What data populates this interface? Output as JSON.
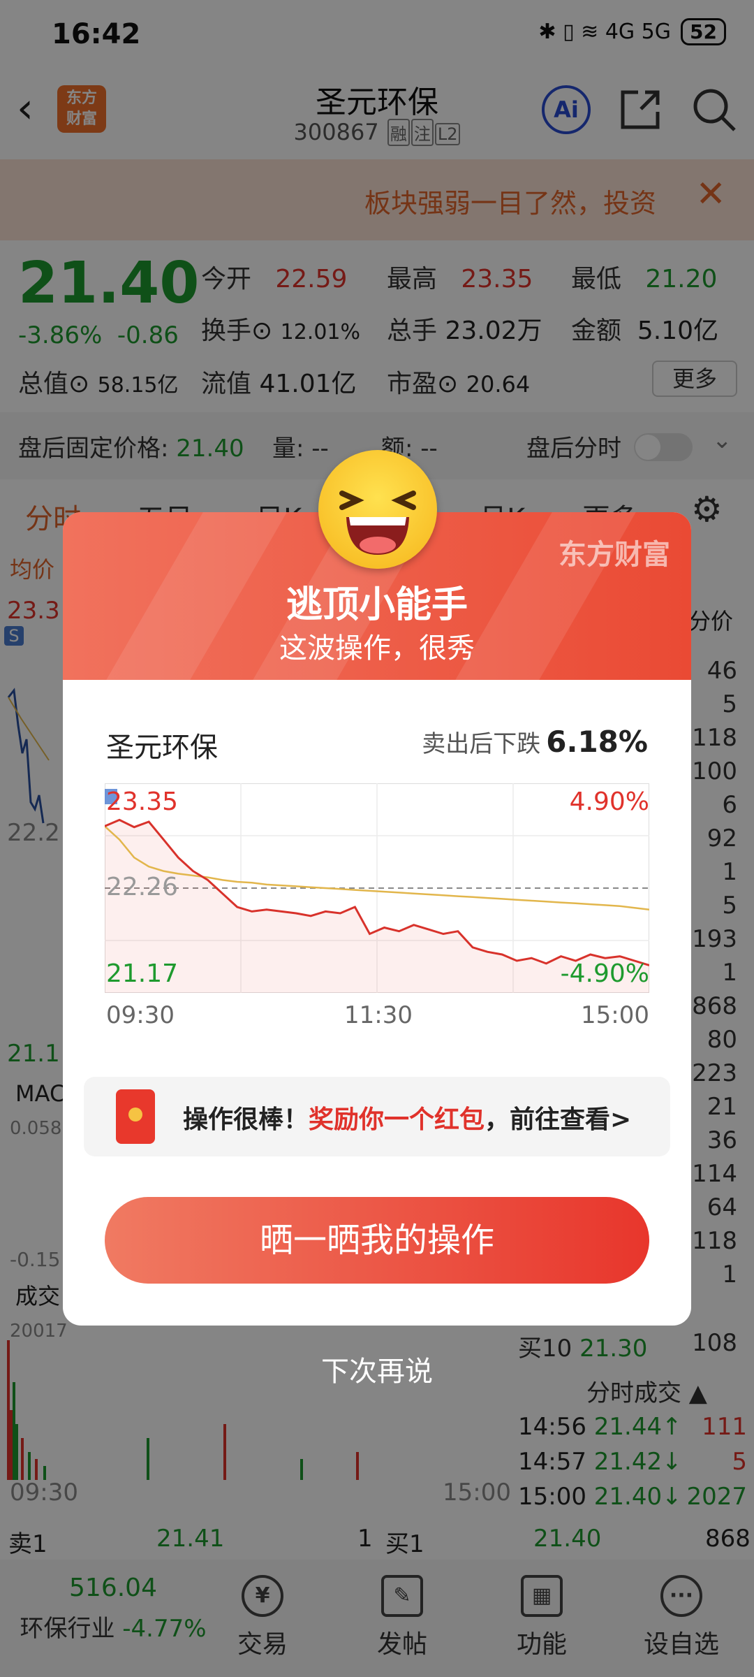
{
  "status_bar": {
    "time": "16:42",
    "signals": "✱ ▯ ≋ 4G 5G",
    "battery": "52"
  },
  "header": {
    "logo_text": "东方\n财富",
    "stock_name": "圣元环保",
    "stock_code": "300867",
    "tags": [
      "融",
      "注",
      "L2"
    ]
  },
  "banner": {
    "text": "板块强弱一目了然，投资",
    "close": "✕"
  },
  "quote": {
    "price": "21.40",
    "change_pct": "-3.86%",
    "change": "-0.86",
    "open_label": "今开",
    "open": "22.59",
    "high_label": "最高",
    "high": "23.35",
    "low_label": "最低",
    "low": "21.20",
    "turnover_label": "换手",
    "turnover": "12.01%",
    "volume_label": "总手",
    "volume": "23.02万",
    "amount_label": "金额",
    "amount": "5.10亿",
    "mcap_label": "总值",
    "mcap": "58.15亿",
    "float_label": "流值",
    "float": "41.01亿",
    "pe_label": "市盈",
    "pe": "20.64",
    "more": "更多"
  },
  "after_hours": {
    "label": "盘后固定价格:",
    "price": "21.40",
    "vol": "量: --",
    "amt": "额: --",
    "toggle_label": "盘后分时"
  },
  "tabs": [
    "分时",
    "五日",
    "日K",
    "周K",
    "月K",
    "更多"
  ],
  "side_labels": {
    "avg": "均价",
    "high": "23.3",
    "mid": "22.2",
    "low": "21.1",
    "macd": "MAC",
    "macd_val": "0.058",
    "macd_low": "-0.15",
    "vol_label": "成交",
    "vol_max": "20017",
    "t_start": "09:30",
    "t_end": "15:00",
    "depth_label": "分价"
  },
  "right_list": [
    "46",
    "5",
    "118",
    "100",
    "6",
    "92",
    "1",
    "5",
    "193",
    "1",
    "868",
    "80",
    "223",
    "21",
    "36",
    "114",
    "64",
    "118",
    "1"
  ],
  "bid10": {
    "label": "买10",
    "price": "21.30",
    "vol": "108"
  },
  "ticks_title": "分时成交",
  "ticks": [
    {
      "time": "14:56",
      "price": "21.44↑",
      "vol": "111"
    },
    {
      "time": "14:57",
      "price": "21.42↓",
      "vol": "5"
    },
    {
      "time": "15:00",
      "price": "21.40↓",
      "vol": "2027"
    }
  ],
  "bidbar": {
    "sell1": "卖1",
    "sell1_price": "21.41",
    "sell1_vol": "1",
    "buy1": "买1",
    "buy1_price": "21.40",
    "buy1_vol": "868"
  },
  "bottom_nav": {
    "sector_value": "516.04",
    "sector_name": "环保行业",
    "sector_chg": "-4.77%",
    "items": [
      "交易",
      "发帖",
      "功能",
      "设自选"
    ]
  },
  "modal": {
    "brand": "东方财富",
    "title": "逃顶小能手",
    "subtitle": "这波操作，很秀",
    "stock": "圣元环保",
    "drop_label": "卖出后下跌",
    "drop_value": "6.18%",
    "chart_high": "23.35",
    "chart_mid": "22.26",
    "chart_low": "21.17",
    "pct_high": "4.90%",
    "pct_low": "-4.90%",
    "x_start": "09:30",
    "x_mid": "11:30",
    "x_end": "15:00",
    "rp_a": "操作很棒！",
    "rp_b": "奖励你一个红包",
    "rp_c": "，前往查看>",
    "share_button": "晒一晒我的操作"
  },
  "later": "下次再说",
  "chart_data": {
    "type": "line",
    "series": [
      {
        "values": [
          22.95,
          23.02,
          22.94,
          23.0,
          22.8,
          22.6,
          22.45,
          22.35,
          22.2,
          22.05,
          22.0,
          22.02,
          22.0,
          21.98,
          21.95,
          22.0,
          21.98,
          22.05,
          21.75,
          21.82,
          21.78,
          21.85,
          21.8,
          21.75,
          21.78,
          21.6,
          21.55,
          21.52,
          21.45,
          21.48,
          21.42,
          21.5,
          21.45,
          21.52,
          21.48,
          21.5,
          21.45,
          21.4
        ]
      },
      {
        "values": [
          22.95,
          22.8,
          22.6,
          22.5,
          22.45,
          22.42,
          22.4,
          22.38,
          22.35,
          22.33,
          22.32,
          22.3,
          22.29,
          22.28,
          22.27,
          22.26,
          22.25,
          22.24,
          22.23,
          22.22,
          22.21,
          22.2,
          22.19,
          22.18,
          22.17,
          22.16,
          22.15,
          22.14,
          22.13,
          22.12,
          22.11,
          22.1,
          22.09,
          22.08,
          22.07,
          22.06,
          22.04,
          22.02
        ]
      }
    ],
    "ylim": [
      21.17,
      23.35
    ],
    "reference": 22.26,
    "x_labels": [
      "09:30",
      "11:30",
      "15:00"
    ],
    "colors": [
      "#d8322b",
      "#e2b64c"
    ]
  }
}
